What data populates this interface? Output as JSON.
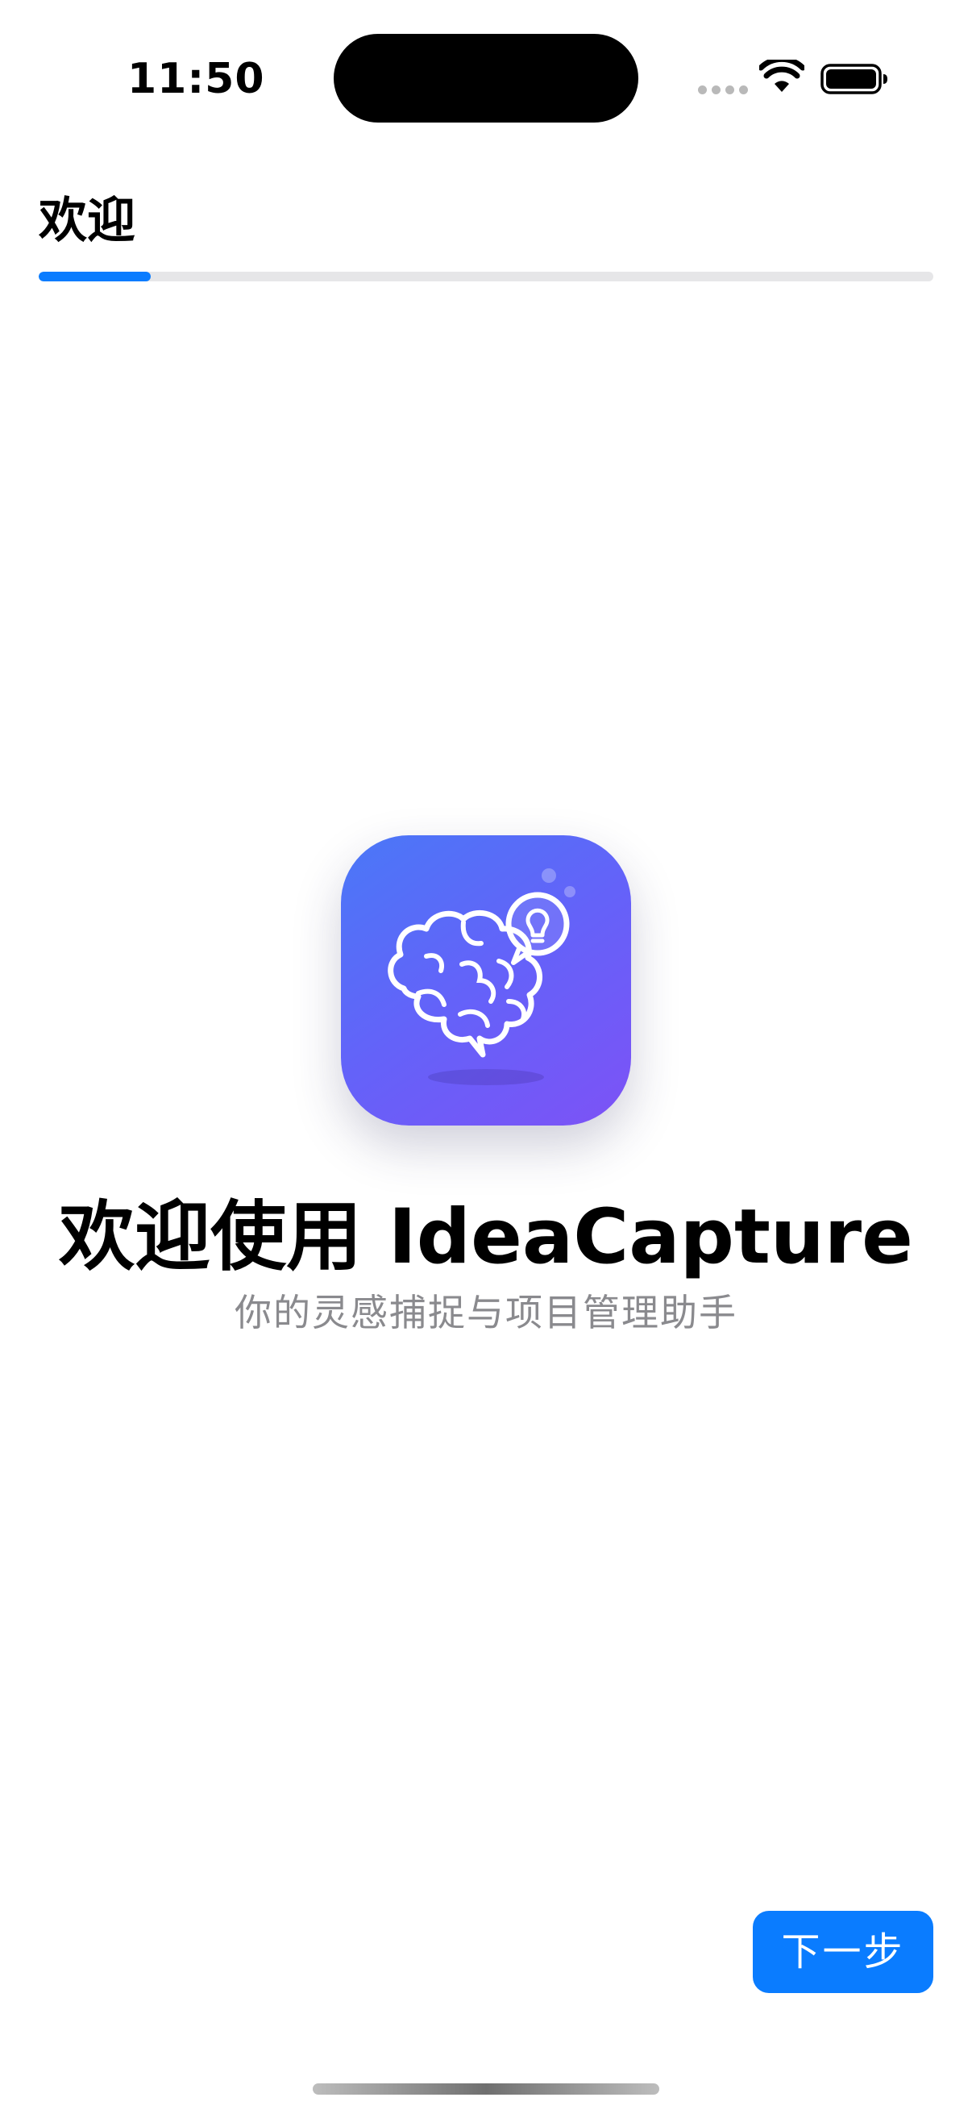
{
  "status_bar": {
    "time": "11:50"
  },
  "header": {
    "title": "欢迎",
    "progress_fraction": 0.125,
    "progress_color": "#0a7cff"
  },
  "hero": {
    "app_icon": "brain-lightbulb-icon",
    "title": "欢迎使用 IdeaCapture",
    "subtitle": "你的灵感捕捉与项目管理助手"
  },
  "footer": {
    "next_label": "下一步",
    "accent_color": "#0a7cff"
  }
}
